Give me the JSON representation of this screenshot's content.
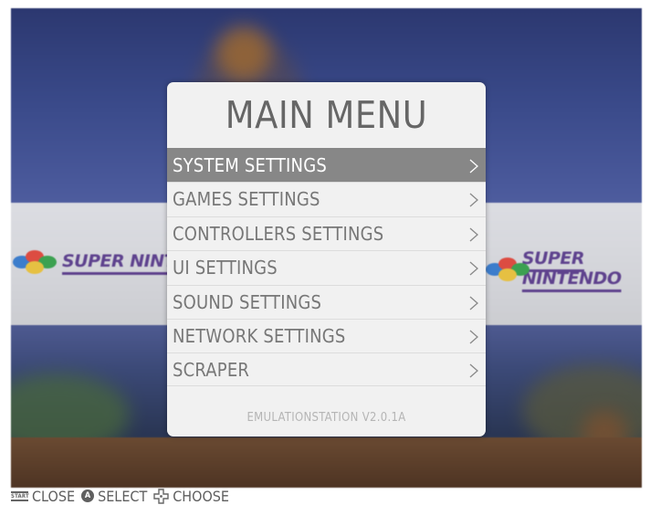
{
  "background": {
    "banner_left_text": "SUPER NINTENDO",
    "banner_right_text": "SUPER NINTENDO"
  },
  "menu": {
    "title": "MAIN MENU",
    "items": [
      {
        "label": "SYSTEM SETTINGS",
        "selected": true,
        "icon": "chevron-right-icon"
      },
      {
        "label": "GAMES SETTINGS",
        "selected": false,
        "icon": "chevron-right-icon"
      },
      {
        "label": "CONTROLLERS SETTINGS",
        "selected": false,
        "icon": "chevron-right-icon"
      },
      {
        "label": "UI SETTINGS",
        "selected": false,
        "icon": "chevron-right-icon"
      },
      {
        "label": "SOUND SETTINGS",
        "selected": false,
        "icon": "chevron-right-icon"
      },
      {
        "label": "NETWORK SETTINGS",
        "selected": false,
        "icon": "chevron-right-icon"
      },
      {
        "label": "SCRAPER",
        "selected": false,
        "icon": "chevron-right-icon"
      }
    ],
    "version": "EMULATIONSTATION V2.0.1A"
  },
  "helpbar": {
    "start_icon_text": "START",
    "a_icon_text": "A",
    "close_label": "CLOSE",
    "select_label": "SELECT",
    "choose_label": "CHOOSE"
  },
  "colors": {
    "selected_row": "#878787",
    "panel": "#f1f1f1",
    "text": "#777777"
  }
}
